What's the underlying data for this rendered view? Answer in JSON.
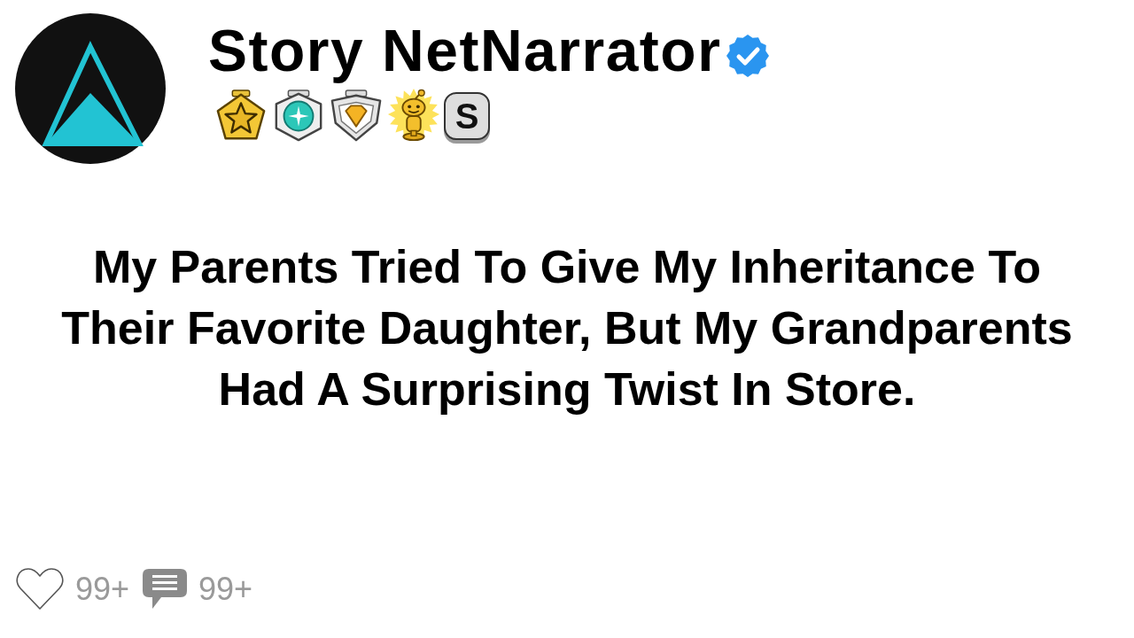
{
  "profile": {
    "name": "Story NetNarrator",
    "verified": true,
    "badges": [
      {
        "kind": "star"
      },
      {
        "kind": "gem"
      },
      {
        "kind": "shield"
      },
      {
        "kind": "trophy"
      },
      {
        "kind": "letter",
        "label": "S"
      }
    ]
  },
  "post": {
    "title": "My Parents Tried To Give My Inheritance To Their Favorite Daughter, But My Grandparents Had A Surprising Twist In Store."
  },
  "footer": {
    "likes": {
      "liked": false,
      "count": "99+"
    },
    "comments": {
      "count": "99+"
    }
  }
}
